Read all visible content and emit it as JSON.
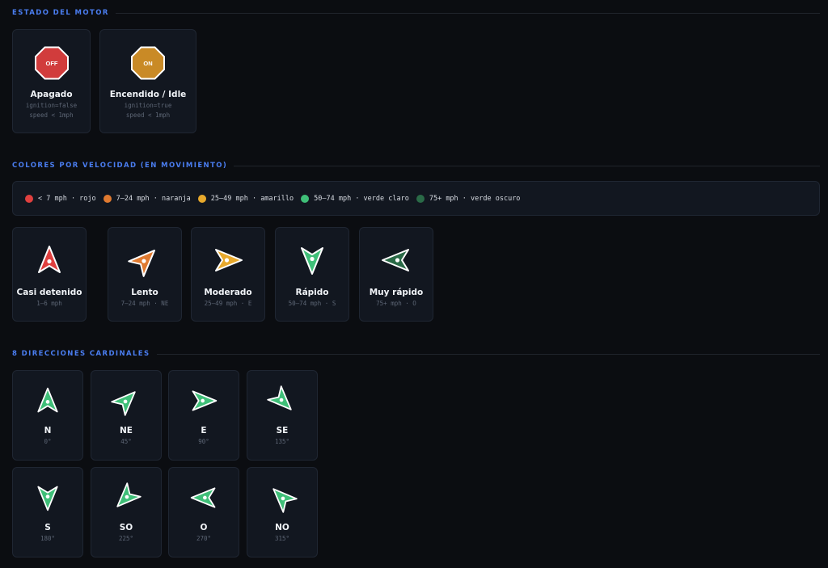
{
  "sections": {
    "engine": "ESTADO DEL MOTOR",
    "speed": "COLORES POR VELOCIDAD (EN MOVIMIENTO)",
    "directions": "8 DIRECCIONES CARDINALES"
  },
  "engine_cards": [
    {
      "badge": "OFF",
      "label": "Apagado",
      "line1": "ignition=false",
      "line2": "speed < 1mph",
      "color": "#d13c3c",
      "icon": "stop-octagon-icon"
    },
    {
      "badge": "ON",
      "label": "Encendido / Idle",
      "line1": "ignition=true",
      "line2": "speed < 1mph",
      "color": "#c98a26",
      "icon": "idle-octagon-icon"
    }
  ],
  "legend": [
    {
      "text": "< 7 mph · rojo",
      "color": "#e0403f"
    },
    {
      "text": "7–24 mph · naranja",
      "color": "#e07a30"
    },
    {
      "text": "25–49 mph · amarillo",
      "color": "#e8a92c"
    },
    {
      "text": "50–74 mph · verde claro",
      "color": "#3fbf78"
    },
    {
      "text": "75+ mph · verde oscuro",
      "color": "#2a6a47"
    }
  ],
  "speed_cards": [
    {
      "label": "Casi detenido",
      "sub": "1–6 mph",
      "color": "#e0403f",
      "heading": 0,
      "icon": "arrow-north-icon"
    },
    {
      "label": "Lento",
      "sub": "7–24 mph · NE",
      "color": "#e07a30",
      "heading": 45,
      "icon": "arrow-northeast-icon"
    },
    {
      "label": "Moderado",
      "sub": "25–49 mph · E",
      "color": "#e8a92c",
      "heading": 90,
      "icon": "arrow-east-icon"
    },
    {
      "label": "Rápido",
      "sub": "50–74 mph · S",
      "color": "#3fbf78",
      "heading": 180,
      "icon": "arrow-south-icon"
    },
    {
      "label": "Muy rápido",
      "sub": "75+ mph · O",
      "color": "#2a6a47",
      "heading": 270,
      "icon": "arrow-west-icon"
    }
  ],
  "direction_cards": [
    {
      "label": "N",
      "sub": "0°",
      "heading": 0
    },
    {
      "label": "NE",
      "sub": "45°",
      "heading": 45
    },
    {
      "label": "E",
      "sub": "90°",
      "heading": 90
    },
    {
      "label": "SE",
      "sub": "135°",
      "heading": 135
    },
    {
      "label": "S",
      "sub": "180°",
      "heading": 180
    },
    {
      "label": "SO",
      "sub": "225°",
      "heading": 225
    },
    {
      "label": "O",
      "sub": "270°",
      "heading": 270
    },
    {
      "label": "NO",
      "sub": "315°",
      "heading": 315
    }
  ],
  "direction_color": "#3fbf78"
}
